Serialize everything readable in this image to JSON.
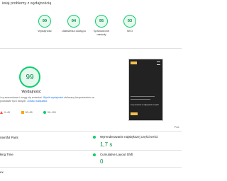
{
  "header": {
    "title": "iwiaj problemy z wydajnością"
  },
  "categories": [
    {
      "score": "99",
      "label": "Wydajność"
    },
    {
      "score": "94",
      "label": "Ułatwienia dostępu"
    },
    {
      "score": "95",
      "label": "Sprawdzone metody"
    },
    {
      "score": "93",
      "label": "SEO"
    }
  ],
  "summary": {
    "score": "99",
    "label": "Wydajność",
    "desc_part1": "i są szacunkowe i mogą się zmieniać. ",
    "desc_link1": "Wynik wydajności",
    "desc_part2": " obliczany bezpośrednio na podstawie tych danych. ",
    "desc_link2": "Zobacz kalkulator",
    "desc_part3": "."
  },
  "legend": {
    "fail": "0–49",
    "average": "50–89",
    "pass": "90–100"
  },
  "screenshot": {
    "text": "Ceny kurierów w najlepszych cenach!",
    "note": "Pod"
  },
  "metrics": [
    {
      "label": "ntentful Paint",
      "value": ""
    },
    {
      "label": "Wyrenderowanie największej części treści",
      "value": "1,7 s"
    },
    {
      "label": "king Time",
      "value": ""
    },
    {
      "label": "Cumulative Layout Shift",
      "value": "0"
    },
    {
      "label": "ex",
      "value": ""
    }
  ],
  "colors": {
    "pass": "#0cce6b",
    "average": "#ffa400",
    "fail": "#ff4e42"
  }
}
